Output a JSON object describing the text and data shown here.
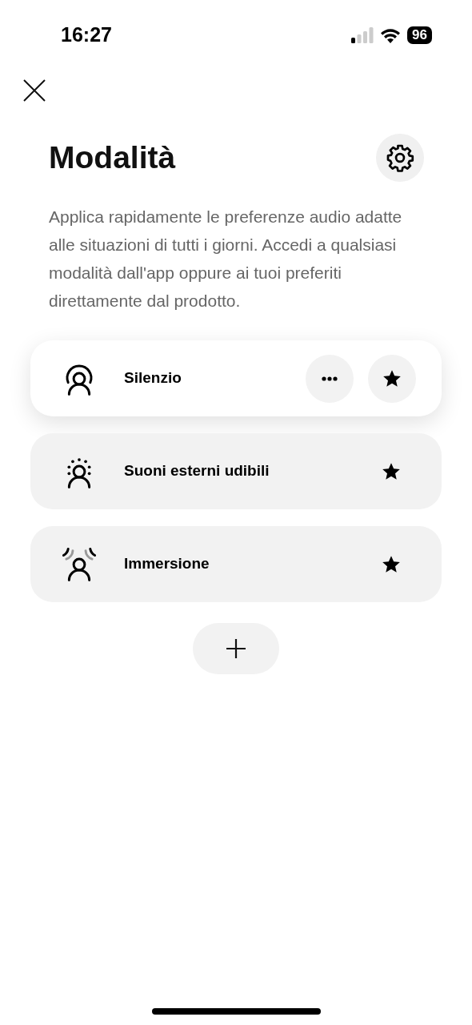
{
  "status_bar": {
    "time": "16:27",
    "battery": "96"
  },
  "title": "Modalità",
  "description": "Applica rapidamente le preferenze audio adatte alle situazioni di tutti i giorni. Accedi a qualsiasi modalità dall'app oppure ai tuoi preferiti direttamente dal prodotto.",
  "modes": [
    {
      "name": "Silenzio",
      "kind": "quiet",
      "selected": true
    },
    {
      "name": "Suoni esterni udibili",
      "kind": "aware",
      "selected": false
    },
    {
      "name": "Immersione",
      "kind": "immersion",
      "selected": false
    }
  ]
}
